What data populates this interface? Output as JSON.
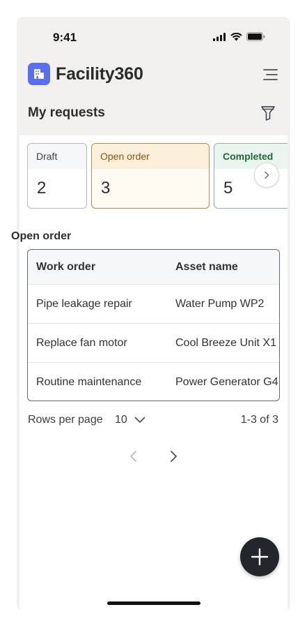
{
  "status_bar": {
    "time": "9:41"
  },
  "app": {
    "title": "Facility360"
  },
  "page": {
    "title": "My requests"
  },
  "status_cards": [
    {
      "label": "Draft",
      "count": "2"
    },
    {
      "label": "Open order",
      "count": "3",
      "selected": true
    },
    {
      "label": "Completed",
      "count": "5"
    }
  ],
  "table": {
    "label": "Open order",
    "columns": [
      "Work order",
      "Asset name"
    ],
    "rows": [
      {
        "work_order": "Pipe leakage repair",
        "asset_name": "Water Pump WP2"
      },
      {
        "work_order": "Replace fan motor",
        "asset_name": "Cool Breeze Unit X1"
      },
      {
        "work_order": "Routine maintenance",
        "asset_name": "Power Generator G4"
      }
    ]
  },
  "pagination": {
    "rows_per_page_label": "Rows per page",
    "rows_per_page_value": "10",
    "range_text": "1-3 of 3"
  },
  "colors": {
    "brand": "#5a6ef0",
    "open_order_accent": "#b8893e",
    "completed_accent": "#1f6b3c",
    "fab": "#23272b"
  },
  "icons": [
    "signal-icon",
    "wifi-icon",
    "battery-icon",
    "building-icon",
    "hamburger-menu-icon",
    "filter-icon",
    "chevron-right-icon",
    "chevron-down-icon",
    "chevron-left-icon",
    "plus-icon"
  ]
}
